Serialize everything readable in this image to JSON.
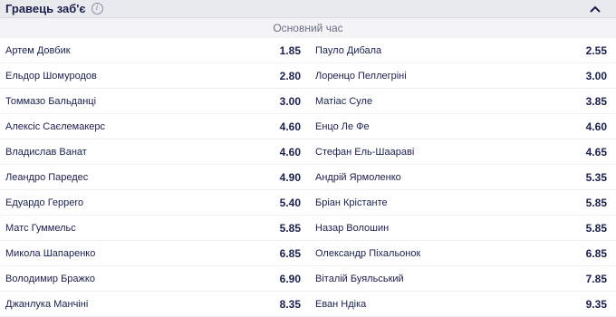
{
  "market": {
    "title": "Гравець заб'є",
    "info_icon": "i"
  },
  "period": {
    "label": "Основний час"
  },
  "rows": [
    {
      "left": {
        "name": "Артем Довбик",
        "odd": "1.85"
      },
      "right": {
        "name": "Пауло Дибала",
        "odd": "2.55"
      }
    },
    {
      "left": {
        "name": "Ельдор Шомуродов",
        "odd": "2.80"
      },
      "right": {
        "name": "Лоренцо Пеллегріні",
        "odd": "3.00"
      }
    },
    {
      "left": {
        "name": "Томмазо Бальданці",
        "odd": "3.00"
      },
      "right": {
        "name": "Матіас Суле",
        "odd": "3.85"
      }
    },
    {
      "left": {
        "name": "Алексіс Саєлемакерс",
        "odd": "4.60"
      },
      "right": {
        "name": "Енцо Ле Фе",
        "odd": "4.60"
      }
    },
    {
      "left": {
        "name": "Владислав Ванат",
        "odd": "4.60"
      },
      "right": {
        "name": "Стефан Ель-Шаараві",
        "odd": "4.65"
      }
    },
    {
      "left": {
        "name": "Леандро Паредес",
        "odd": "4.90"
      },
      "right": {
        "name": "Андрій Ярмоленко",
        "odd": "5.35"
      }
    },
    {
      "left": {
        "name": "Едуардо Геррero",
        "odd": "5.40"
      },
      "right": {
        "name": "Бріан Крістанте",
        "odd": "5.85"
      }
    },
    {
      "left": {
        "name": "Матс Гуммельс",
        "odd": "5.85"
      },
      "right": {
        "name": "Назар Волошин",
        "odd": "5.85"
      }
    },
    {
      "left": {
        "name": "Микола Шапаренко",
        "odd": "6.85"
      },
      "right": {
        "name": "Олександр Піхальонок",
        "odd": "6.85"
      }
    },
    {
      "left": {
        "name": "Володимир Бражко",
        "odd": "6.90"
      },
      "right": {
        "name": "Віталій Буяльський",
        "odd": "7.85"
      }
    },
    {
      "left": {
        "name": "Джанлука Манчіні",
        "odd": "8.35"
      },
      "right": {
        "name": "Еван Ндіка",
        "odd": "9.35"
      }
    }
  ],
  "colors": {
    "text": "#1a1f4e",
    "header_bg": "#e9eaee",
    "subheader_bg": "#f4f4f6"
  }
}
